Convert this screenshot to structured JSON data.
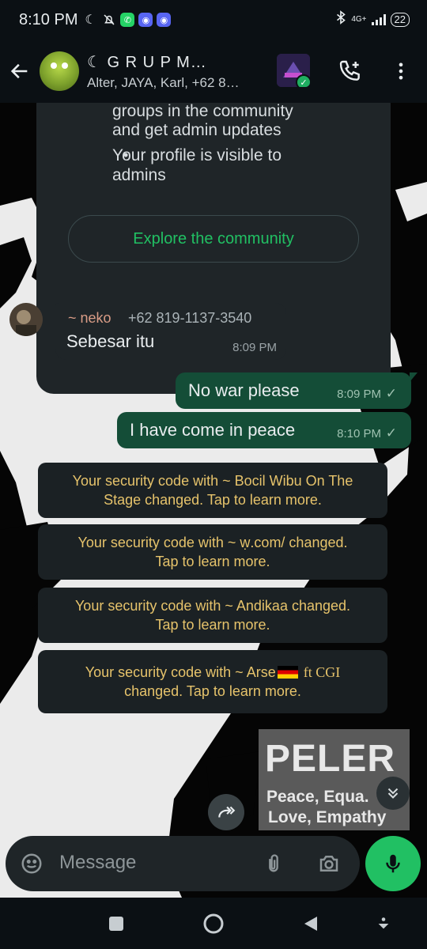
{
  "status_bar": {
    "time": "8:10 PM",
    "network": "4G+",
    "battery": "22",
    "icons": [
      "moon-icon",
      "bell-off-icon",
      "whatsapp-icon",
      "discord-icon",
      "discord-icon",
      "bluetooth-icon",
      "signal-icon",
      "battery-icon"
    ]
  },
  "header": {
    "title": "☾ G R U P  M…",
    "subtitle": "Alter, JAYA, Karl, +62 8…",
    "icons": [
      "back-arrow-icon",
      "group-avatar",
      "community-avatar",
      "add-call-icon",
      "more-vert-icon"
    ]
  },
  "community_card": {
    "line1": "groups in the community",
    "line2": "and get admin updates",
    "bullet_line1": "Your profile is visible to",
    "bullet_line2": "admins",
    "explore_button": "Explore the community"
  },
  "messages": [
    {
      "type": "incoming",
      "sender": "~ neko",
      "phone": "+62 819-1137-3540",
      "text": "Sebesar itu",
      "time": "8:09 PM"
    },
    {
      "type": "outgoing",
      "text": "No war please",
      "time": "8:09 PM",
      "status": "✓"
    },
    {
      "type": "outgoing",
      "text": "I have come in peace",
      "time": "8:10 PM",
      "status": "✓"
    }
  ],
  "system_messages": [
    {
      "line1": "Your security code with ~ Bocil Wibu On The",
      "line2": "Stage changed. Tap to learn more."
    },
    {
      "line1": "Your security code with ~ ẉ.com/ changed.",
      "line2": "Tap to learn more."
    },
    {
      "line1": "Your security code with ~ Andikaa changed.",
      "line2": "Tap to learn more."
    },
    {
      "line1a": "Your security code with ~ Arse",
      "line1b": "ft CGI",
      "line2": "changed. Tap to learn more."
    }
  ],
  "sticker": {
    "big": "PELER",
    "line1": "Peace, Equa.",
    "line2": "Love, Empathy"
  },
  "input": {
    "placeholder": "Message"
  },
  "colors": {
    "outgoing_bubble": "#144d37",
    "incoming_bubble": "#1f2528",
    "system_text": "#e6c36b",
    "accent_green": "#21c063"
  }
}
